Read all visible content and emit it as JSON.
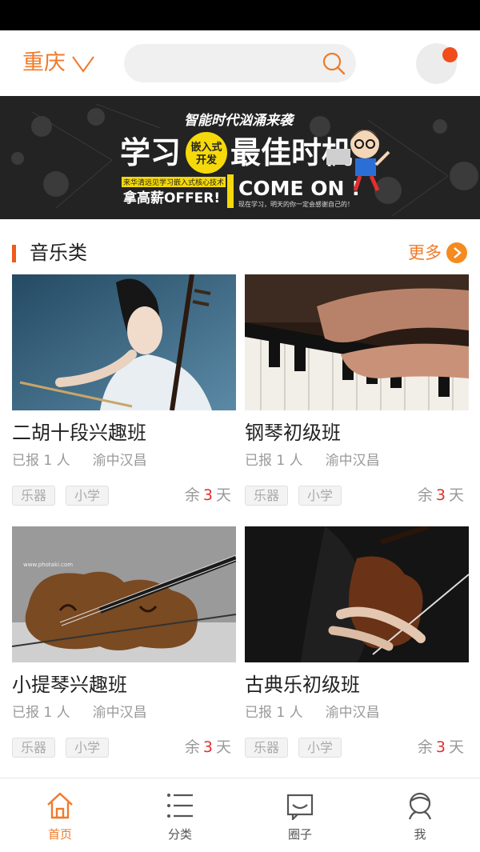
{
  "header": {
    "city": "重庆"
  },
  "banner": {
    "top_slogan": "智能时代汹涌来袭",
    "headline_left": "学习",
    "badge": "嵌入式开发",
    "badge_line1": "嵌入式",
    "badge_line2": "开发",
    "headline_right": "最佳时机",
    "sub_strip": "来华清远见学习嵌入式核心技术",
    "offer": "拿高薪OFFER!",
    "come_on": "COME ON !",
    "footnote": "现在学习，明天的你一定会感谢自己的！",
    "colors": {
      "accent_yellow": "#f5d90a",
      "text_white": "#ffffff",
      "background": "#232323"
    }
  },
  "section": {
    "title": "音乐类",
    "more_label": "更多"
  },
  "courses": [
    {
      "title": "二胡十段兴趣班",
      "enrolled": "已报 1 人",
      "location": "渝中汉昌",
      "tags": [
        "乐器",
        "小学"
      ],
      "remain_prefix": "余",
      "remain_num": "3",
      "remain_suffix": "天",
      "image": "erhu-photo"
    },
    {
      "title": "钢琴初级班",
      "enrolled": "已报 1 人",
      "location": "渝中汉昌",
      "tags": [
        "乐器",
        "小学"
      ],
      "remain_prefix": "余",
      "remain_num": "3",
      "remain_suffix": "天",
      "image": "piano-photo"
    },
    {
      "title": "小提琴兴趣班",
      "enrolled": "已报 1 人",
      "location": "渝中汉昌",
      "tags": [
        "乐器",
        "小学"
      ],
      "remain_prefix": "余",
      "remain_num": "3",
      "remain_suffix": "天",
      "image": "violin-photo",
      "watermark": "www.photaki.com"
    },
    {
      "title": "古典乐初级班",
      "enrolled": "已报 1 人",
      "location": "渝中汉昌",
      "tags": [
        "乐器",
        "小学"
      ],
      "remain_prefix": "余",
      "remain_num": "3",
      "remain_suffix": "天",
      "image": "classical-violin-photo"
    }
  ],
  "tabbar": {
    "items": [
      {
        "label": "首页",
        "icon": "home-icon",
        "active": true
      },
      {
        "label": "分类",
        "icon": "list-icon",
        "active": false
      },
      {
        "label": "圈子",
        "icon": "chat-icon",
        "active": false
      },
      {
        "label": "我",
        "icon": "user-icon",
        "active": false
      }
    ]
  },
  "colors": {
    "accent": "#f07a2a",
    "remain_number": "#e03030",
    "notification": "#f04d1a"
  }
}
